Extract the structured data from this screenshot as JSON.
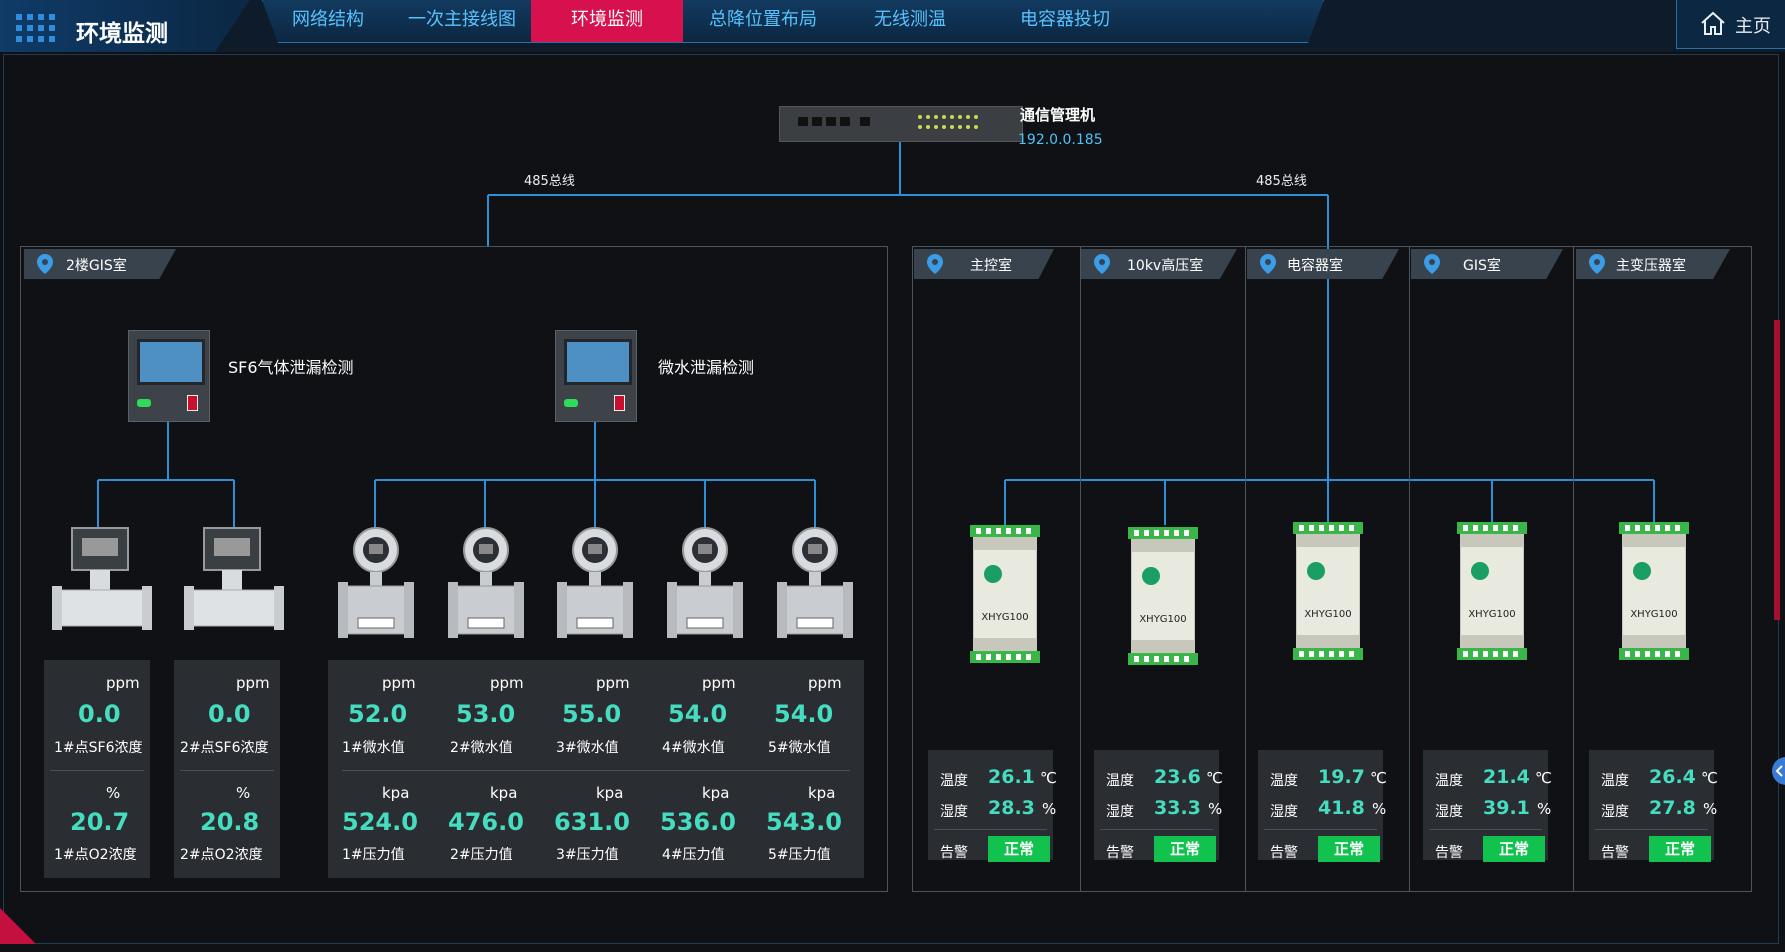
{
  "header": {
    "title": "环境监测",
    "nav": [
      "网络结构",
      "一次主接线图",
      "环境监测",
      "总降位置布局",
      "无线测温",
      "电容器投切"
    ],
    "active_nav": "环境监测",
    "home_label": "主页"
  },
  "switch": {
    "name": "通信管理机",
    "ip": "192.0.0.185"
  },
  "bus_labels": [
    "485总线",
    "485总线"
  ],
  "gis_panel": {
    "location": "2楼GIS室",
    "sf6": {
      "name": "SF6气体泄漏检测",
      "points": [
        {
          "conc_unit": "ppm",
          "conc_value": "0.0",
          "conc_label": "1#点SF6浓度",
          "o2_unit": "%",
          "o2_value": "20.7",
          "o2_label": "1#点O2浓度"
        },
        {
          "conc_unit": "ppm",
          "conc_value": "0.0",
          "conc_label": "2#点SF6浓度",
          "o2_unit": "%",
          "o2_value": "20.8",
          "o2_label": "2#点O2浓度"
        }
      ]
    },
    "micro_water": {
      "name": "微水泄漏检测",
      "points": [
        {
          "ppm_unit": "ppm",
          "ppm_value": "52.0",
          "ppm_label": "1#微水值",
          "kpa_unit": "kpa",
          "kpa_value": "524.0",
          "kpa_label": "1#压力值"
        },
        {
          "ppm_unit": "ppm",
          "ppm_value": "53.0",
          "ppm_label": "2#微水值",
          "kpa_unit": "kpa",
          "kpa_value": "476.0",
          "kpa_label": "2#压力值"
        },
        {
          "ppm_unit": "ppm",
          "ppm_value": "55.0",
          "ppm_label": "3#微水值",
          "kpa_unit": "kpa",
          "kpa_value": "631.0",
          "kpa_label": "3#压力值"
        },
        {
          "ppm_unit": "ppm",
          "ppm_value": "54.0",
          "ppm_label": "4#微水值",
          "kpa_unit": "kpa",
          "kpa_value": "536.0",
          "kpa_label": "4#压力值"
        },
        {
          "ppm_unit": "ppm",
          "ppm_value": "54.0",
          "ppm_label": "5#微水值",
          "kpa_unit": "kpa",
          "kpa_value": "543.0",
          "kpa_label": "5#压力值"
        }
      ]
    }
  },
  "rooms": [
    {
      "name": "主控室",
      "model": "XHYG100",
      "temp_label": "温度",
      "temp": "26.1",
      "temp_unit": "℃",
      "hum_label": "湿度",
      "hum": "28.3",
      "hum_unit": "%",
      "alarm_label": "告警",
      "status": "正常"
    },
    {
      "name": "10kv高压室",
      "model": "XHYG100",
      "temp_label": "温度",
      "temp": "23.6",
      "temp_unit": "℃",
      "hum_label": "湿度",
      "hum": "33.3",
      "hum_unit": "%",
      "alarm_label": "告警",
      "status": "正常"
    },
    {
      "name": "电容器室",
      "model": "XHYG100",
      "temp_label": "温度",
      "temp": "19.7",
      "temp_unit": "℃",
      "hum_label": "湿度",
      "hum": "41.8",
      "hum_unit": "%",
      "alarm_label": "告警",
      "status": "正常"
    },
    {
      "name": "GIS室",
      "model": "XHYG100",
      "temp_label": "温度",
      "temp": "21.4",
      "temp_unit": "℃",
      "hum_label": "湿度",
      "hum": "39.1",
      "hum_unit": "%",
      "alarm_label": "告警",
      "status": "正常"
    },
    {
      "name": "主变压器室",
      "model": "XHYG100",
      "temp_label": "温度",
      "temp": "26.4",
      "temp_unit": "℃",
      "hum_label": "湿度",
      "hum": "27.8",
      "hum_unit": "%",
      "alarm_label": "告警",
      "status": "正常"
    }
  ],
  "colors": {
    "accent": "#45dcbf",
    "nav_active": "#d7114e",
    "nav_text": "#58c2ff",
    "line": "#2e8fd6",
    "ok": "#11c24f"
  }
}
